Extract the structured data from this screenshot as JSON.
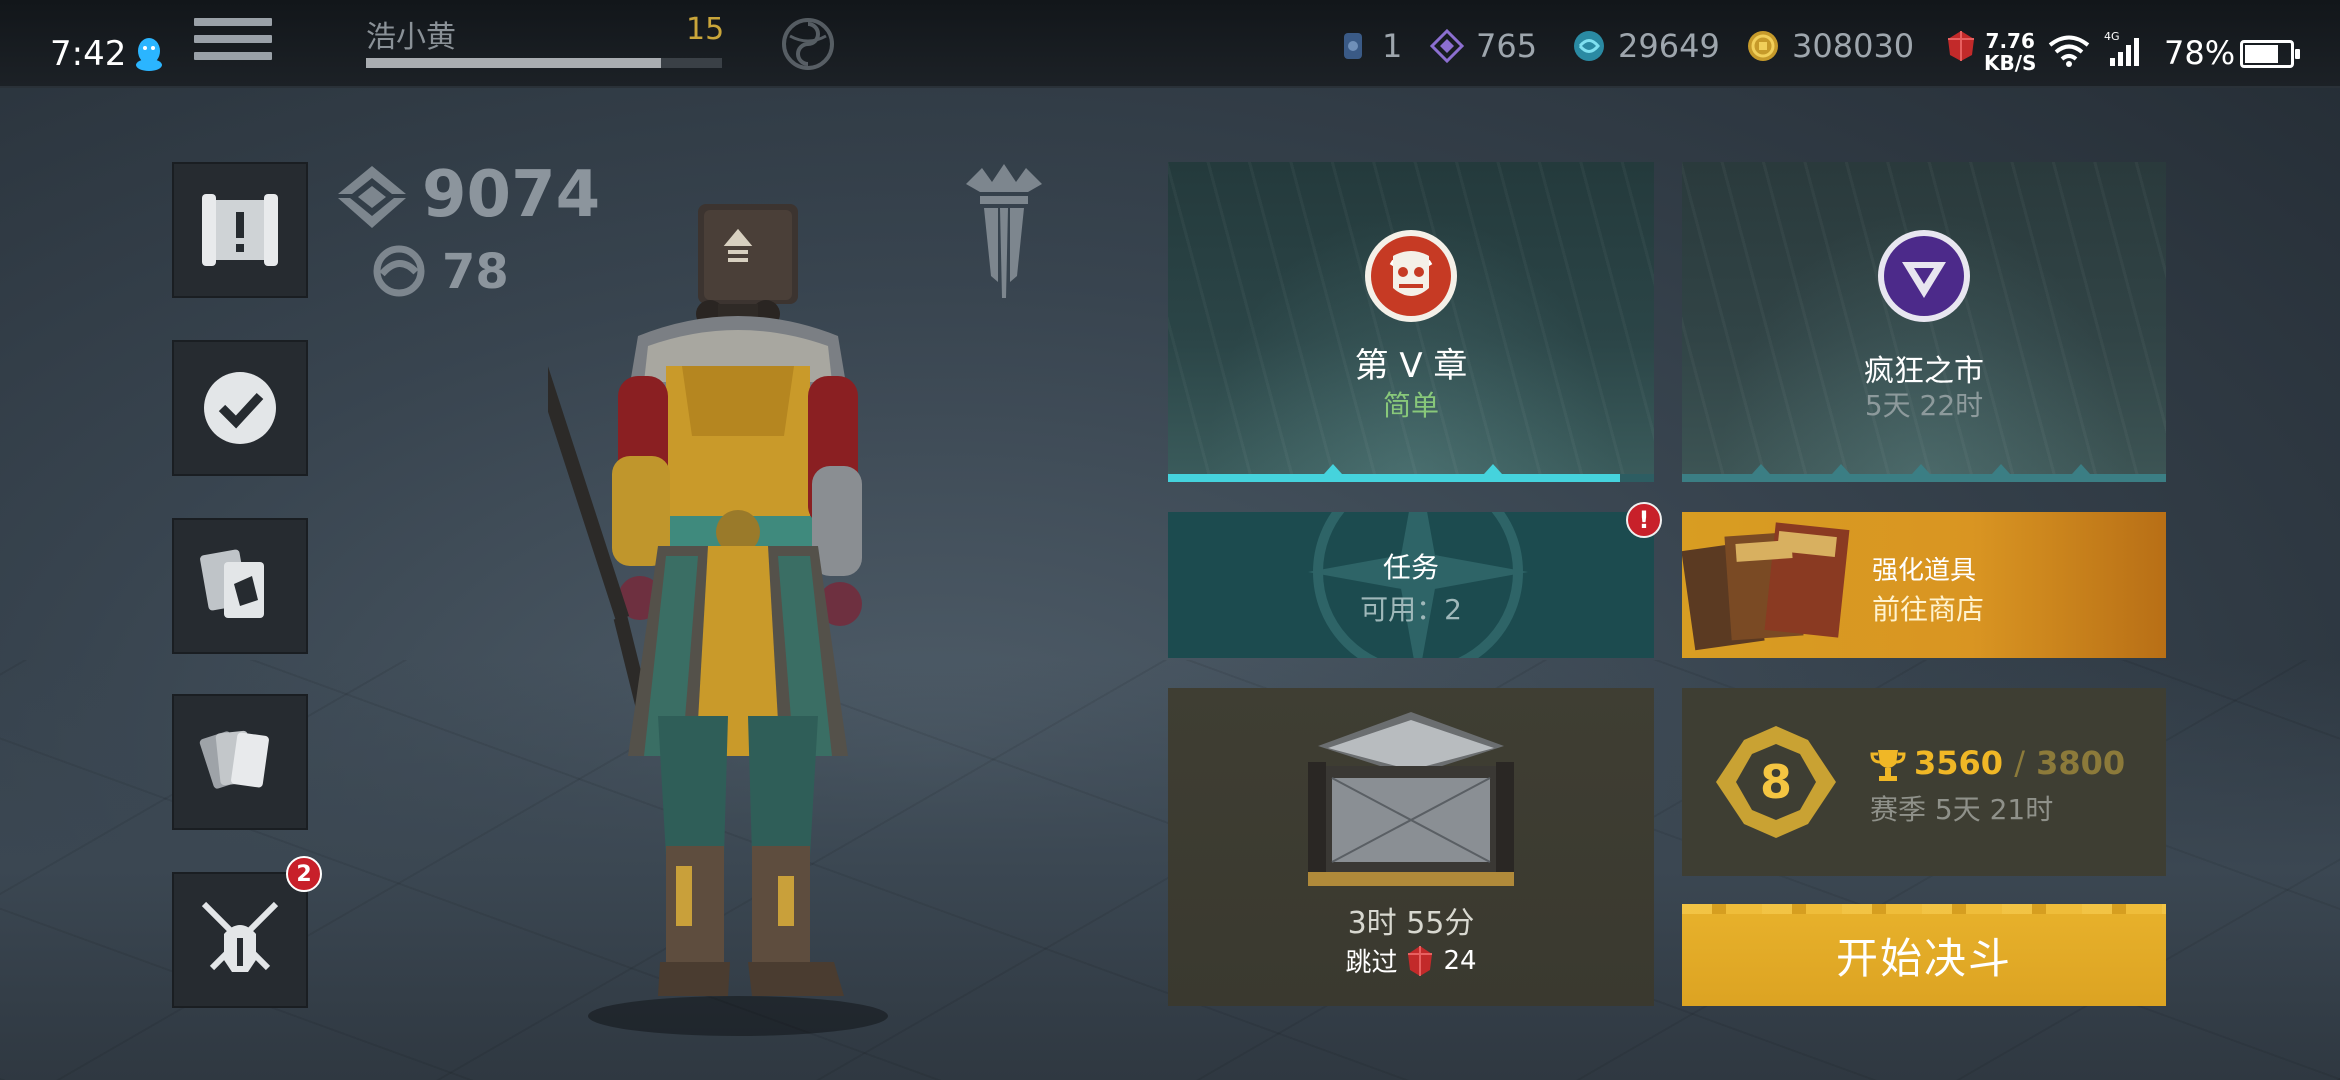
{
  "status_bar": {
    "time": "7:42",
    "net_speed_top": "7.76",
    "net_speed_unit": "KB/S",
    "network_type": "4G",
    "battery": "78%",
    "battery_level": 0.78
  },
  "player": {
    "name": "浩小黄",
    "level": "15",
    "xp_progress": 0.83
  },
  "resources": {
    "keys": "1",
    "crystals": "765",
    "spirit": "29649",
    "coins": "308030"
  },
  "stats": {
    "power": "9074",
    "secondary": "78"
  },
  "side_menu": {
    "battle_badge": "2"
  },
  "tiles": {
    "chapter": {
      "title": "第 V 章",
      "difficulty": "简单",
      "progress": 0.93,
      "accent": "#45d3dd"
    },
    "market": {
      "title": "疯狂之市",
      "timer": "5天 22时"
    },
    "tasks": {
      "title": "任务",
      "available": "可用：2",
      "alert": "!"
    },
    "shop": {
      "title": "强化道具",
      "subtitle": "前往商店"
    },
    "chest": {
      "timer": "3时 55分",
      "skip_label": "跳过",
      "skip_cost": "24"
    },
    "season": {
      "rank": "8",
      "score": "3560",
      "slash": "/",
      "max": "3800",
      "time": "赛季 5天 21时"
    },
    "duel": {
      "label": "开始决斗"
    }
  },
  "colors": {
    "gold": "#f0b726",
    "tasks_teal": "#1c4b4f",
    "alert_red": "#c8202a"
  }
}
